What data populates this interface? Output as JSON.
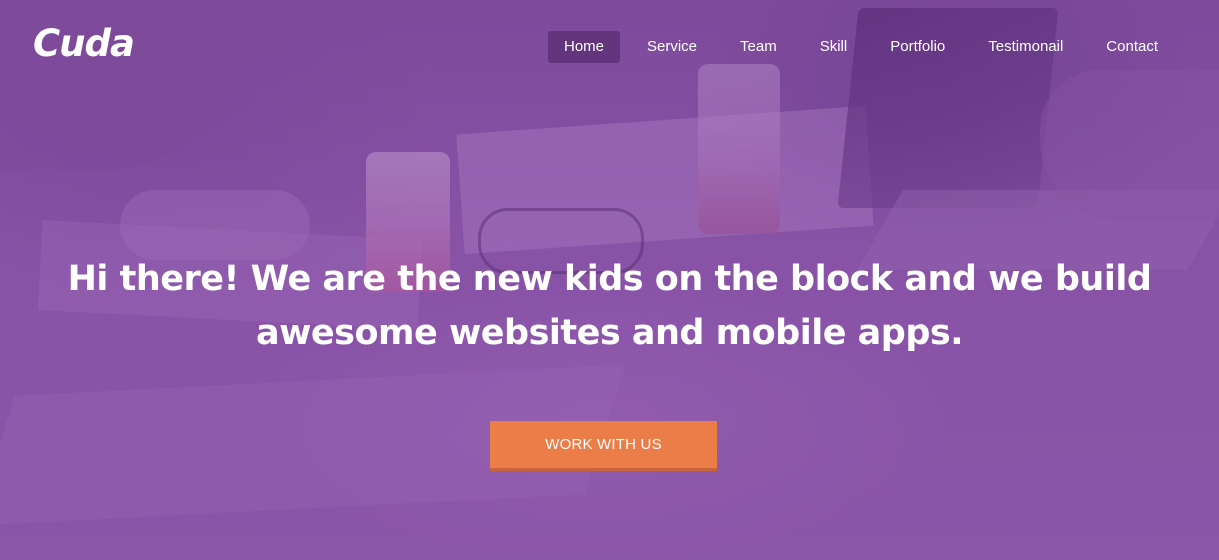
{
  "brand": {
    "logo_text": "Cuda"
  },
  "nav": {
    "items": [
      {
        "label": "Home",
        "active": true
      },
      {
        "label": "Service",
        "active": false
      },
      {
        "label": "Team",
        "active": false
      },
      {
        "label": "Skill",
        "active": false
      },
      {
        "label": "Portfolio",
        "active": false
      },
      {
        "label": "Testimonail",
        "active": false
      },
      {
        "label": "Contact",
        "active": false
      }
    ]
  },
  "hero": {
    "headline_line1": "Hi there! We are the new kids on the block and we build",
    "headline_line2": "awesome websites and mobile apps.",
    "cta_label": "WORK WITH US"
  },
  "colors": {
    "overlay_purple": "#8a56a8",
    "cta_orange": "#ea7d48",
    "nav_active_bg": "#582d73",
    "text": "#ffffff"
  }
}
